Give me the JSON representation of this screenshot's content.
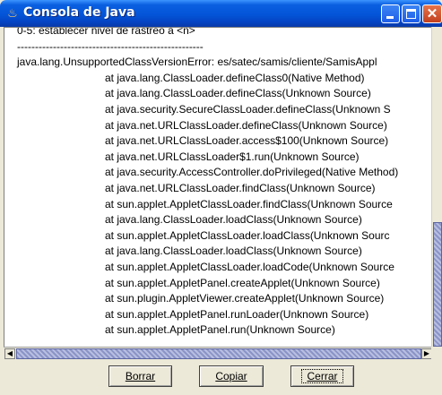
{
  "window": {
    "title": "Consola de Java",
    "icon": "java-coffee-icon"
  },
  "console": {
    "lines": [
      "0-5: establecer nivel de rastreo a <n>",
      "----------------------------------------------------",
      "java.lang.UnsupportedClassVersionError: es/satec/samis/cliente/SamisAppl",
      "\t\tat java.lang.ClassLoader.defineClass0(Native Method)",
      "\t\tat java.lang.ClassLoader.defineClass(Unknown Source)",
      "\t\tat java.security.SecureClassLoader.defineClass(Unknown S",
      "\t\tat java.net.URLClassLoader.defineClass(Unknown Source)",
      "\t\tat java.net.URLClassLoader.access$100(Unknown Source)",
      "\t\tat java.net.URLClassLoader$1.run(Unknown Source)",
      "\t\tat java.security.AccessController.doPrivileged(Native Method)",
      "\t\tat java.net.URLClassLoader.findClass(Unknown Source)",
      "\t\tat sun.applet.AppletClassLoader.findClass(Unknown Source",
      "\t\tat java.lang.ClassLoader.loadClass(Unknown Source)",
      "\t\tat sun.applet.AppletClassLoader.loadClass(Unknown Sourc",
      "\t\tat java.lang.ClassLoader.loadClass(Unknown Source)",
      "\t\tat sun.applet.AppletClassLoader.loadCode(Unknown Source",
      "\t\tat sun.applet.AppletPanel.createApplet(Unknown Source)",
      "\t\tat sun.plugin.AppletViewer.createApplet(Unknown Source)",
      "\t\tat sun.applet.AppletPanel.runLoader(Unknown Source)",
      "\t\tat sun.applet.AppletPanel.run(Unknown Source)"
    ]
  },
  "buttons": {
    "clear": "Borrar",
    "copy": "Copiar",
    "close": "Cerrar"
  }
}
